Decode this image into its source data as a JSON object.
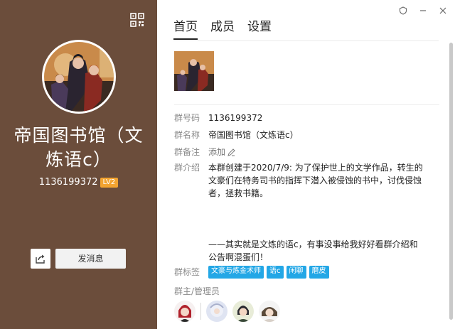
{
  "group": {
    "name": "帝国图书馆（文炼语c）",
    "id": "1136199372",
    "level": "LV2"
  },
  "actions": {
    "send_label": "发消息"
  },
  "tabs": [
    {
      "label": "首页",
      "active": true
    },
    {
      "label": "成员",
      "active": false
    },
    {
      "label": "设置",
      "active": false
    }
  ],
  "info": {
    "id_label": "群号码",
    "id_value": "1136199372",
    "name_label": "群名称",
    "name_value": "帝国图书馆（文炼语c）",
    "remark_label": "群备注",
    "remark_value": "添加",
    "intro_label": "群介绍",
    "intro_value": "本群创建于2020/7/9: 为了保护世上的文学作品，转生的文豪们在特务司书的指挥下潜入被侵蚀的书中，讨伐侵蚀者，拯救书籍。\n\n\n\n——其实就是文炼的语c，有事没事给我好好看群介绍和公告啊混蛋们！",
    "tags_label": "群标签",
    "tags": [
      "文豪与炼金术师",
      "语c",
      "闲聊",
      "磨皮"
    ],
    "admins_label": "群主/管理员"
  },
  "colors": {
    "sidebar": "#6b4d3b",
    "level_badge": "#f3a431",
    "tag": "#23a7e6"
  },
  "icons": [
    "qr-code-icon",
    "share-icon",
    "shield-icon",
    "minimize-icon",
    "close-icon",
    "edit-icon"
  ]
}
